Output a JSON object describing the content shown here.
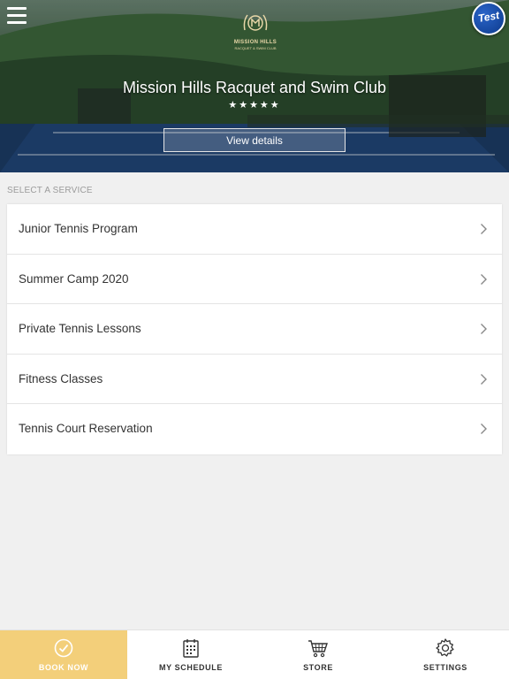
{
  "hero": {
    "logo_text": "MISSION HILLS",
    "logo_subtext": "RACQUET & SWIM CLUB",
    "badge": "Test",
    "title": "Mission Hills Racquet and Swim Club",
    "stars": "★★★★★",
    "view_details": "View details"
  },
  "services": {
    "section_label": "SELECT A SERVICE",
    "items": [
      {
        "label": "Junior Tennis Program"
      },
      {
        "label": "Summer Camp 2020"
      },
      {
        "label": "Private Tennis Lessons"
      },
      {
        "label": "Fitness Classes"
      },
      {
        "label": "Tennis Court Reservation"
      }
    ]
  },
  "nav": {
    "accent_color": "#f3cf7a",
    "items": [
      {
        "label": "BOOK NOW",
        "icon": "check-circle-icon",
        "active": true
      },
      {
        "label": "MY SCHEDULE",
        "icon": "calendar-icon",
        "active": false
      },
      {
        "label": "STORE",
        "icon": "cart-icon",
        "active": false
      },
      {
        "label": "SETTINGS",
        "icon": "gear-icon",
        "active": false
      }
    ]
  }
}
